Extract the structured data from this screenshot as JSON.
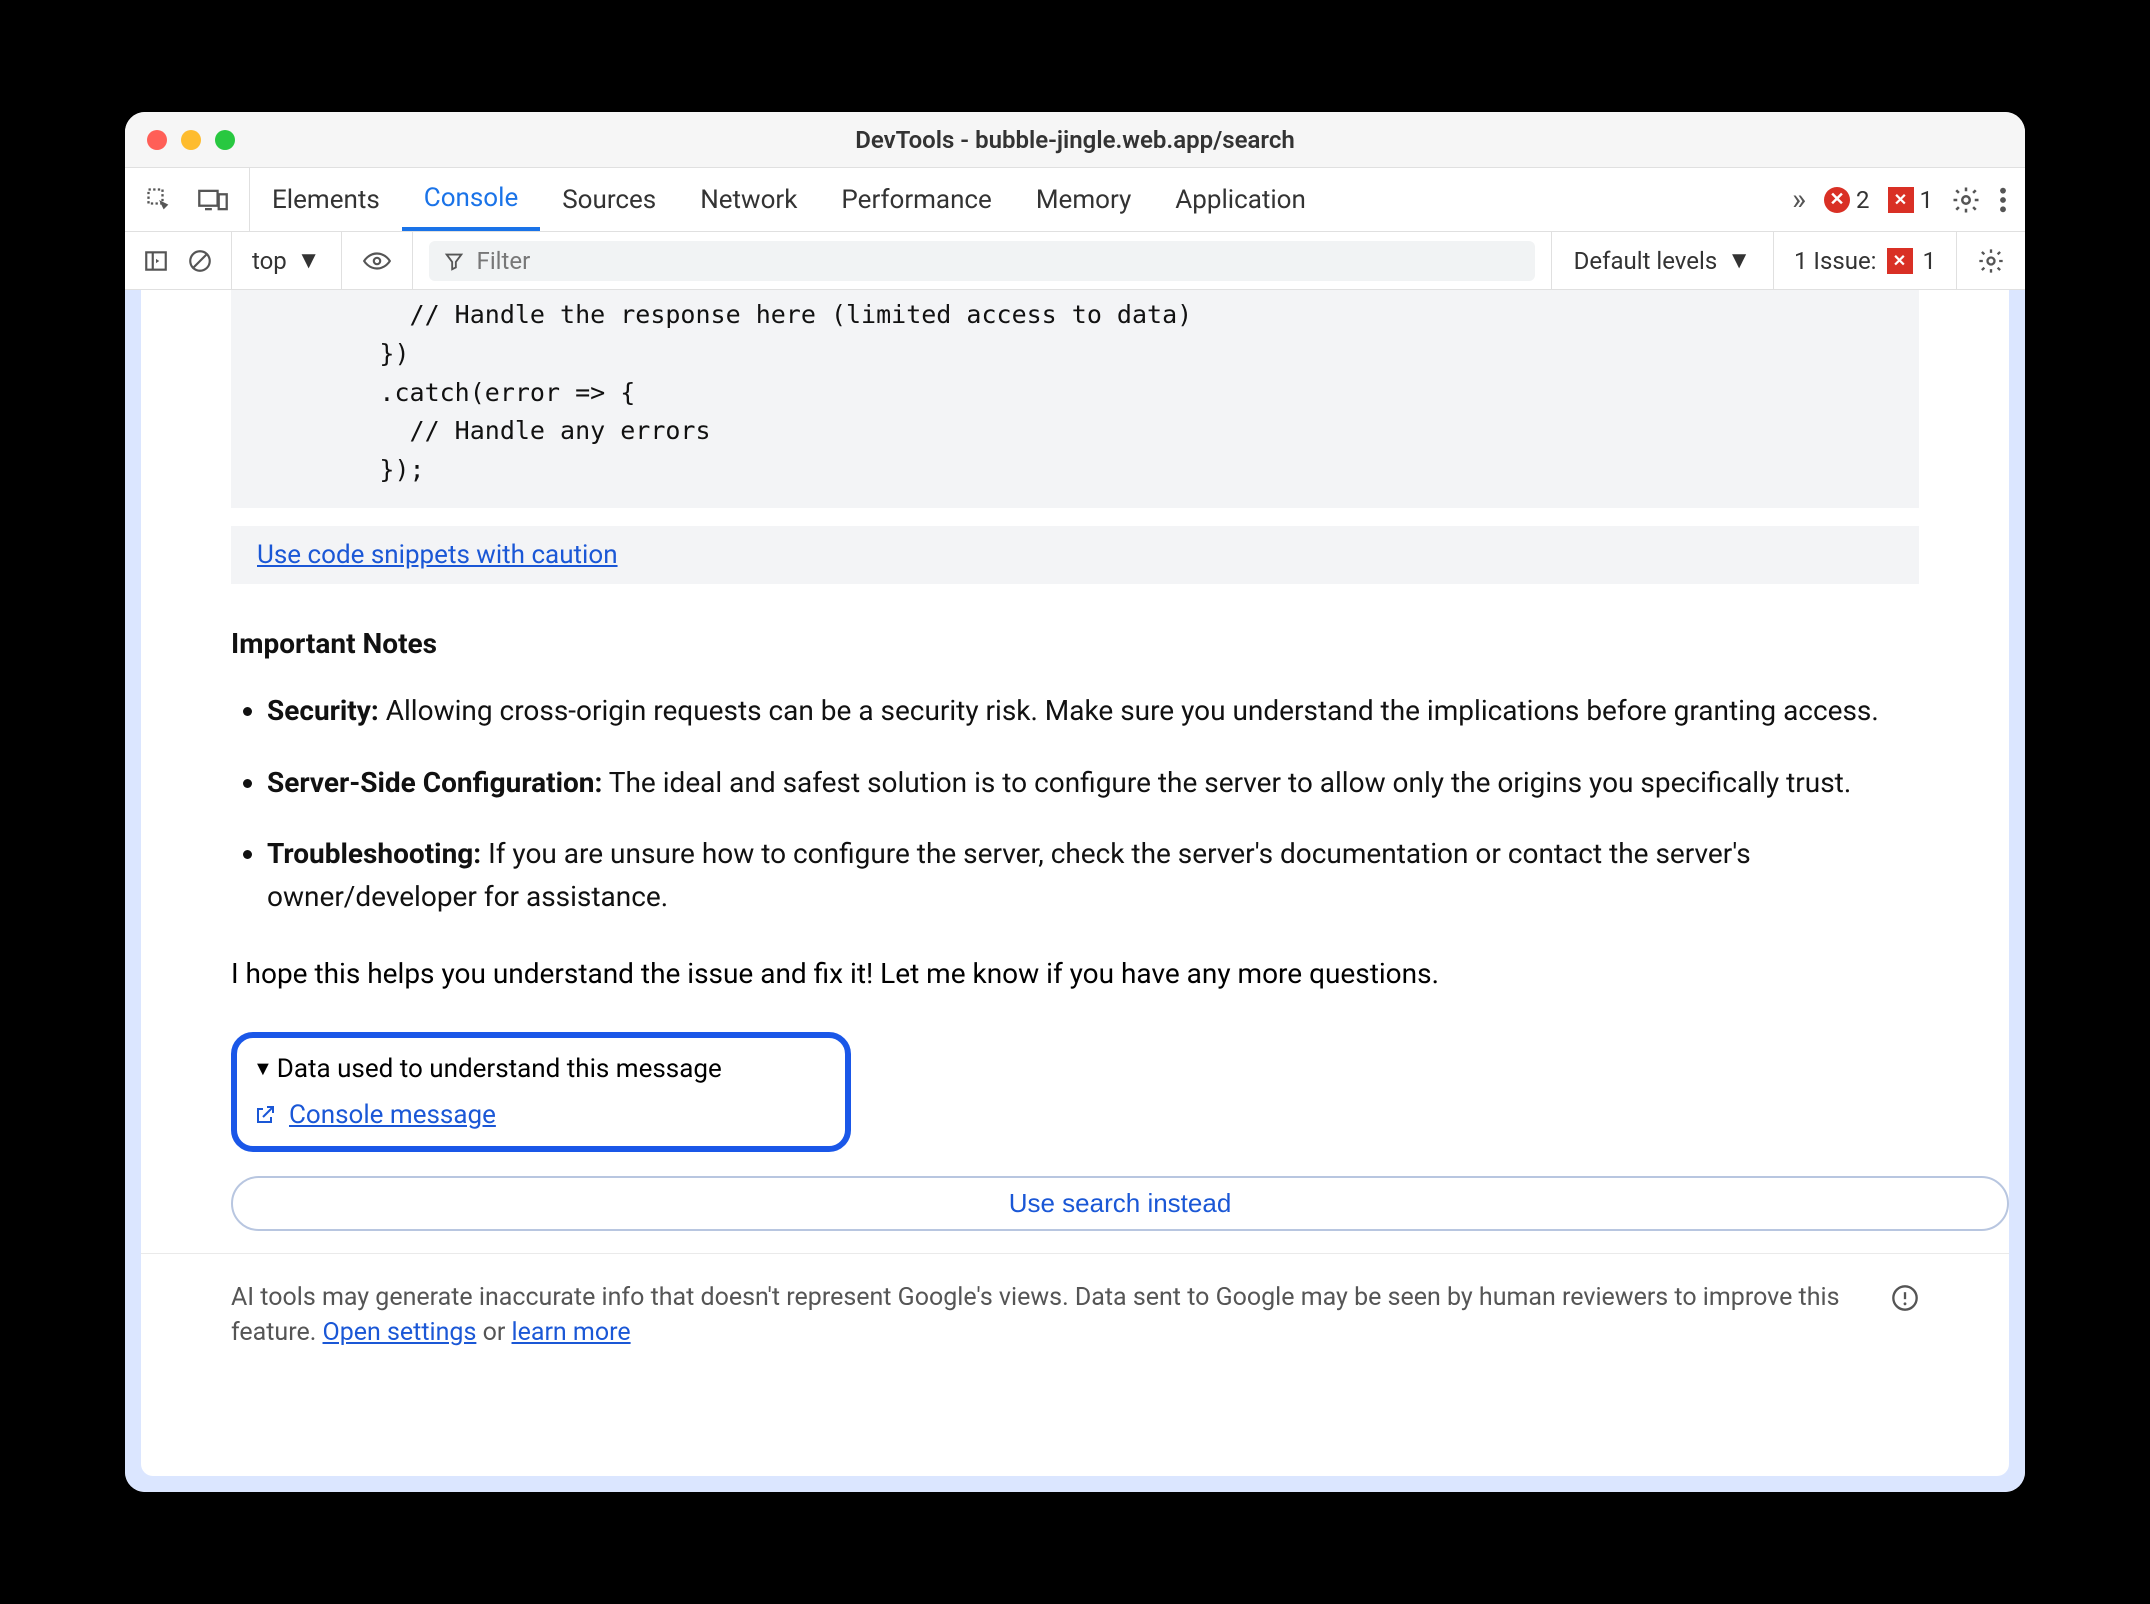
{
  "window": {
    "title": "DevTools - bubble-jingle.web.app/search"
  },
  "tabs": {
    "elements": "Elements",
    "console": "Console",
    "sources": "Sources",
    "network": "Network",
    "performance": "Performance",
    "memory": "Memory",
    "application": "Application"
  },
  "tabbar_right": {
    "error_count": "2",
    "issue_count": "1"
  },
  "toolbar": {
    "context": "top",
    "filter_placeholder": "Filter",
    "levels": "Default levels",
    "issue_label": "1 Issue:",
    "issue_count": "1"
  },
  "code": "          // Handle the response here (limited access to data)\n        })\n        .catch(error => {\n          // Handle any errors\n        });",
  "caution_link": "Use code snippets with caution",
  "notes": {
    "heading": "Important Notes",
    "items": [
      {
        "label": "Security:",
        "text": " Allowing cross-origin requests can be a security risk. Make sure you understand the implications before granting access."
      },
      {
        "label": "Server-Side Configuration:",
        "text": " The ideal and safest solution is to configure the server to allow only the origins you specifically trust."
      },
      {
        "label": "Troubleshooting:",
        "text": " If you are unsure how to configure the server, check the server's documentation or contact the server's owner/developer for assistance."
      }
    ]
  },
  "closing": "I hope this helps you understand the issue and fix it! Let me know if you have any more questions.",
  "data_used": {
    "summary": "Data used to understand this message",
    "link": "Console message"
  },
  "search_btn": "Use search instead",
  "footer": {
    "text_a": "AI tools may generate inaccurate info that doesn't represent Google's views. Data sent to Google may be seen by human reviewers to improve this feature. ",
    "open_settings": "Open settings",
    "or": " or ",
    "learn_more": "learn more"
  }
}
